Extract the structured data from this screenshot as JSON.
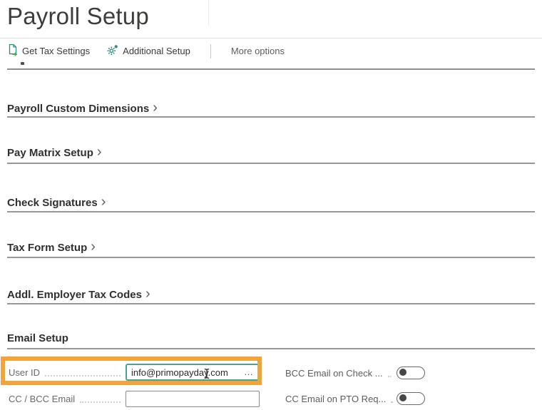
{
  "page": {
    "title": "Payroll Setup"
  },
  "action_bar": {
    "get_tax_settings_label": "Get Tax Settings",
    "additional_setup_label": "Additional Setup",
    "more_options_label": "More options"
  },
  "glyphs": {
    "chevron": "›",
    "assist_edit": "…"
  },
  "sections": {
    "payroll_custom_dimensions": "Payroll Custom Dimensions",
    "pay_matrix_setup": "Pay Matrix Setup",
    "check_signatures": "Check Signatures",
    "tax_form_setup": "Tax Form Setup",
    "addl_employer_tax_codes": "Addl. Employer Tax Codes",
    "email_setup": "Email Setup"
  },
  "email_setup": {
    "user_id": {
      "label": "User ID",
      "value": "info@primopayday.com"
    },
    "cc_bcc_email": {
      "label": "CC / BCC Email",
      "value": ""
    },
    "bcc_on_check": {
      "label": "BCC Email on Check ...",
      "state": "off"
    },
    "cc_on_pto": {
      "label": "CC Email on PTO Req...",
      "state": "off"
    }
  },
  "colors": {
    "highlight_orange": "#F2A43C",
    "focus_teal": "#46A394",
    "icon_teal": "#2A8C7C",
    "icon_green": "#3FAF46",
    "section_rule": "#979797"
  }
}
